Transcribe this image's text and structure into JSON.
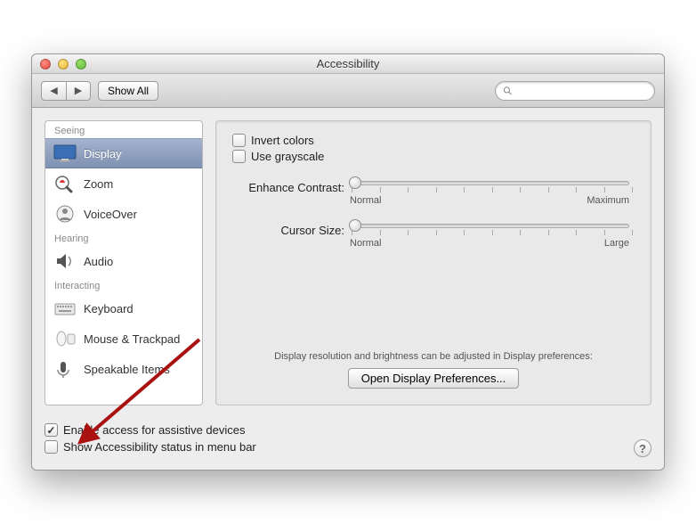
{
  "title": "Accessibility",
  "toolbar": {
    "show_all": "Show All",
    "search_placeholder": ""
  },
  "sidebar": {
    "groups": [
      {
        "label": "Seeing",
        "items": [
          {
            "id": "display",
            "label": "Display",
            "selected": true
          },
          {
            "id": "zoom",
            "label": "Zoom"
          },
          {
            "id": "voiceover",
            "label": "VoiceOver"
          }
        ]
      },
      {
        "label": "Hearing",
        "items": [
          {
            "id": "audio",
            "label": "Audio"
          }
        ]
      },
      {
        "label": "Interacting",
        "items": [
          {
            "id": "keyboard",
            "label": "Keyboard"
          },
          {
            "id": "mouse",
            "label": "Mouse & Trackpad"
          },
          {
            "id": "speakable",
            "label": "Speakable Items"
          }
        ]
      }
    ]
  },
  "pane": {
    "invert_colors": {
      "label": "Invert colors",
      "checked": false
    },
    "use_grayscale": {
      "label": "Use grayscale",
      "checked": false
    },
    "contrast": {
      "label": "Enhance Contrast:",
      "min_label": "Normal",
      "max_label": "Maximum"
    },
    "cursor": {
      "label": "Cursor Size:",
      "min_label": "Normal",
      "max_label": "Large"
    },
    "hint": "Display resolution and brightness can be adjusted in Display preferences:",
    "open_button": "Open Display Preferences..."
  },
  "bottom": {
    "enable_assistive": {
      "label": "Enable access for assistive devices",
      "checked": true
    },
    "show_status": {
      "label": "Show Accessibility status in menu bar",
      "checked": false
    }
  }
}
